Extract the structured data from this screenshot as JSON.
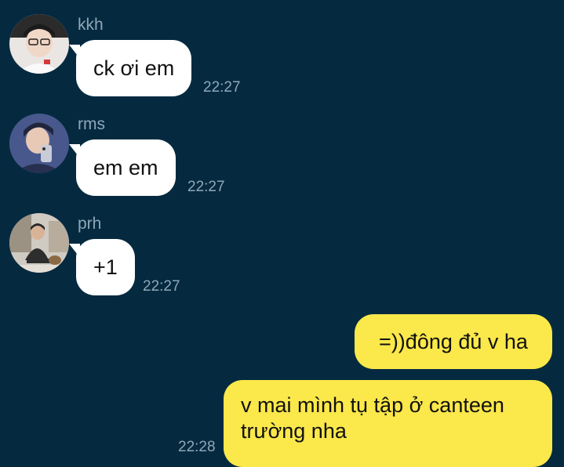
{
  "colors": {
    "background": "#052a40",
    "incoming_bubble": "#ffffff",
    "outgoing_bubble": "#fbe84a",
    "meta_text": "#8fa7b8"
  },
  "messages": {
    "incoming": [
      {
        "sender": "kkh",
        "text": "ck ơi em",
        "time": "22:27",
        "avatar_icon": "user-avatar-icon"
      },
      {
        "sender": "rms",
        "text": "em em",
        "time": "22:27",
        "avatar_icon": "user-avatar-icon"
      },
      {
        "sender": "prh",
        "text": "+1",
        "time": "22:27",
        "avatar_icon": "user-avatar-icon"
      }
    ],
    "outgoing": [
      {
        "text": "=))đông đủ v ha",
        "time": ""
      },
      {
        "text": "v mai mình tụ tập ở canteen trường nha",
        "time": "22:28"
      }
    ]
  }
}
